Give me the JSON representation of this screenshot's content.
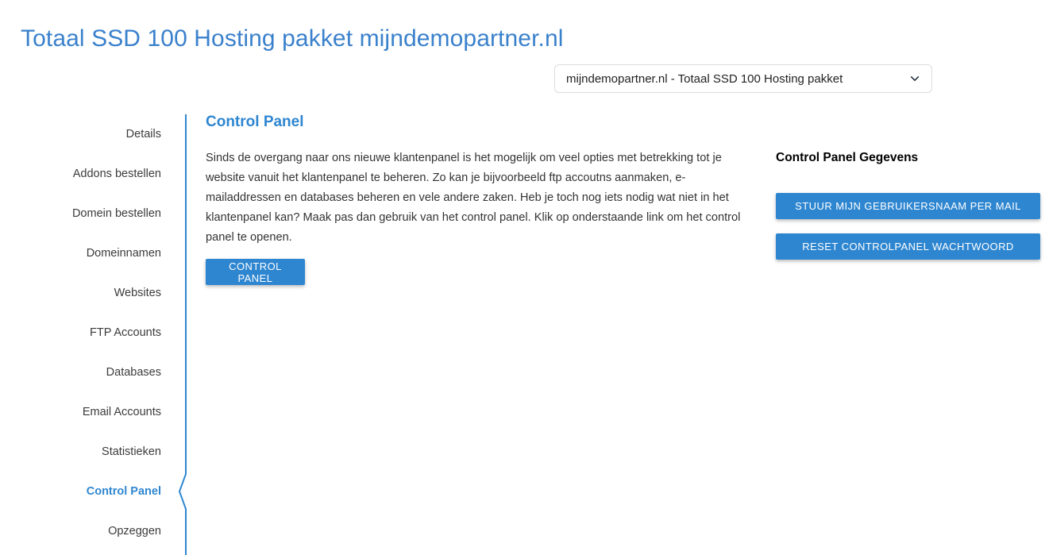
{
  "page": {
    "title": "Totaal SSD 100 Hosting pakket mijndemopartner.nl"
  },
  "selector": {
    "value": "mijndemopartner.nl - Totaal SSD 100 Hosting pakket",
    "icon": "chevron-down-icon"
  },
  "sidebar": {
    "items": [
      {
        "label": "Details",
        "active": false
      },
      {
        "label": "Addons bestellen",
        "active": false
      },
      {
        "label": "Domein bestellen",
        "active": false
      },
      {
        "label": "Domeinnamen",
        "active": false
      },
      {
        "label": "Websites",
        "active": false
      },
      {
        "label": "FTP Accounts",
        "active": false
      },
      {
        "label": "Databases",
        "active": false
      },
      {
        "label": "Email Accounts",
        "active": false
      },
      {
        "label": "Statistieken",
        "active": false
      },
      {
        "label": "Control Panel",
        "active": true
      },
      {
        "label": "Opzeggen",
        "active": false
      }
    ]
  },
  "main": {
    "heading": "Control Panel",
    "paragraph": "Sinds de overgang naar ons nieuwe klantenpanel is het mogelijk om veel opties met betrekking tot je website vanuit het klantenpanel te beheren. Zo kan je bijvoorbeeld ftp accoutns aanmaken, e-mailaddressen en databases beheren en vele andere zaken. Heb je toch nog iets nodig wat niet in het klantenpanel kan? Maak pas dan gebruik van het control panel. Klik op onderstaande link om het control panel te openen.",
    "control_panel_button": "CONTROL PANEL"
  },
  "right_column": {
    "heading": "Control Panel Gegevens",
    "send_username_button": "STUUR MIJN GEBRUIKERSNAAM PER MAIL",
    "reset_password_button": "RESET CONTROLPANEL WACHTWOORD"
  },
  "colors": {
    "title_blue": "#3a81cc",
    "accent_blue": "#2e86d0",
    "divider_blue": "#2e86d0",
    "body_text": "#333333",
    "background": "#ffffff"
  }
}
